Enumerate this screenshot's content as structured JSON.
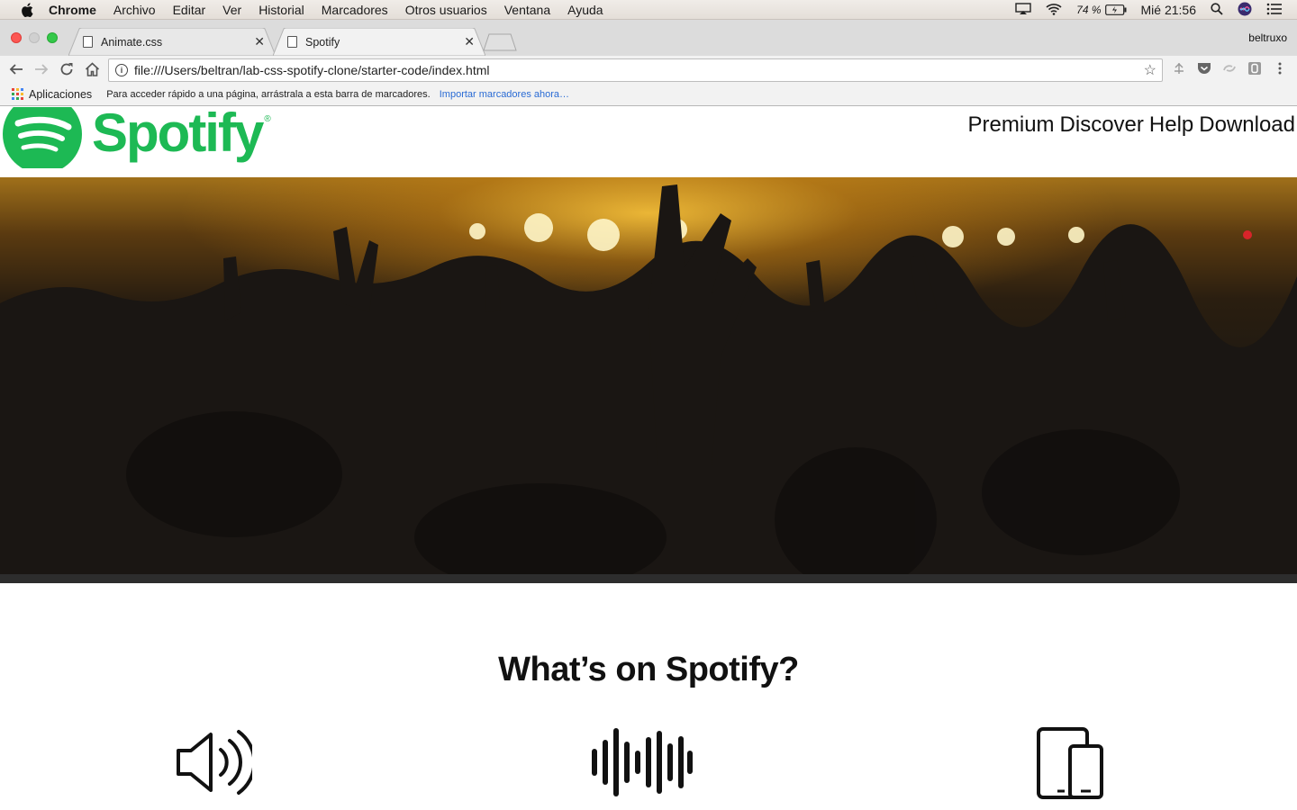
{
  "menubar": {
    "app": "Chrome",
    "items": [
      "Archivo",
      "Editar",
      "Ver",
      "Historial",
      "Marcadores",
      "Otros usuarios",
      "Ventana",
      "Ayuda"
    ],
    "battery": "74 %",
    "clock": "Mié 21:56"
  },
  "tabs": [
    {
      "label": "Animate.css"
    },
    {
      "label": "Spotify"
    }
  ],
  "user": "beltruxo",
  "address": {
    "url": "file:///Users/beltran/lab-css-spotify-clone/starter-code/index.html"
  },
  "bookmarks": {
    "apps": "Aplicaciones",
    "hint": "Para acceder rápido a una página, arrástrala a esta barra de marcadores.",
    "import_link": "Importar marcadores ahora…"
  },
  "page": {
    "logo_text": "Spotify",
    "logo_reg": "®",
    "nav": [
      "Premium",
      "Discover",
      "Help",
      "Download"
    ],
    "heading": "What’s on Spotify?"
  },
  "colors": {
    "brand": "#1db954"
  },
  "icons": [
    "speaker-icon",
    "soundwave-icon",
    "devices-icon"
  ]
}
